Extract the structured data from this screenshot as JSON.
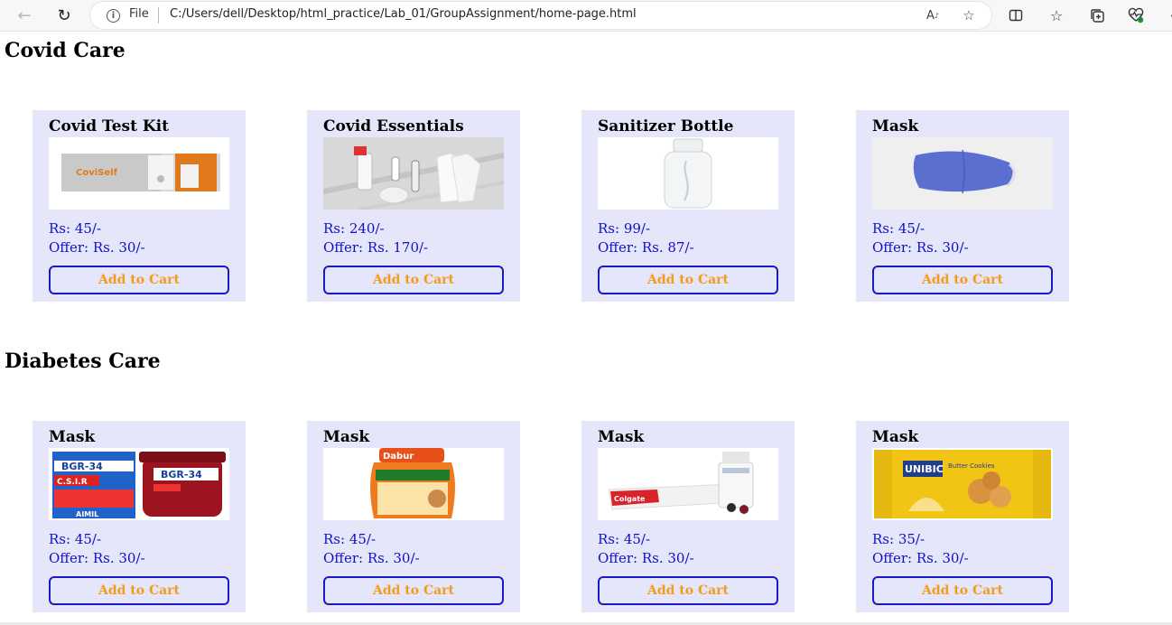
{
  "browser": {
    "file_label": "File",
    "url": "C:/Users/dell/Desktop/html_practice/Lab_01/GroupAssignment/home-page.html"
  },
  "sections": [
    {
      "heading": "Covid Care",
      "cards": [
        {
          "title": "Covid Test Kit",
          "image": "covid-test-kit-image",
          "price": "Rs: 45/-",
          "offer": "Offer: Rs. 30/-",
          "button": "Add to Cart"
        },
        {
          "title": "Covid Essentials",
          "image": "covid-essentials-image",
          "price": "Rs: 240/-",
          "offer": "Offer: Rs. 170/-",
          "button": "Add to Cart"
        },
        {
          "title": "Sanitizer Bottle",
          "image": "sanitizer-bottle-image",
          "price": "Rs: 99/-",
          "offer": "Offer: Rs. 87/-",
          "button": "Add to Cart"
        },
        {
          "title": "Mask",
          "image": "mask-image",
          "price": "Rs: 45/-",
          "offer": "Offer: Rs. 30/-",
          "button": "Add to Cart"
        }
      ]
    },
    {
      "heading": "Diabetes Care",
      "cards": [
        {
          "title": "Mask",
          "image": "bgr-34-image",
          "price": "Rs: 45/-",
          "offer": "Offer: Rs. 30/-",
          "button": "Add to Cart"
        },
        {
          "title": "Mask",
          "image": "chyawanprakash-image",
          "price": "Rs: 45/-",
          "offer": "Offer: Rs. 30/-",
          "button": "Add to Cart"
        },
        {
          "title": "Mask",
          "image": "toothpaste-image",
          "price": "Rs: 45/-",
          "offer": "Offer: Rs. 30/-",
          "button": "Add to Cart"
        },
        {
          "title": "Mask",
          "image": "cookies-image",
          "price": "Rs: 35/-",
          "offer": "Offer: Rs. 30/-",
          "button": "Add to Cart"
        }
      ]
    }
  ],
  "product_image_text": {
    "coviself": "CoviSelf",
    "bgr34": "BGR-34",
    "csir": "C.S.I.R",
    "aimil": "AIMIL",
    "dabur": "Dabur",
    "colgate": "Colgate",
    "unibic": "UNIBIC",
    "butter_cookies": "Butter Cookies"
  },
  "colors": {
    "card_bg": "#e6e6fa",
    "price_text": "#1010cc",
    "button_border": "#1a1acc",
    "button_text": "#f39b1c"
  },
  "icons": [
    "back-arrow-icon",
    "refresh-icon",
    "info-icon",
    "read-aloud-icon",
    "favorite-star-icon",
    "split-screen-icon",
    "favorites-icon",
    "collections-icon",
    "browser-essentials-icon",
    "more-icon"
  ]
}
